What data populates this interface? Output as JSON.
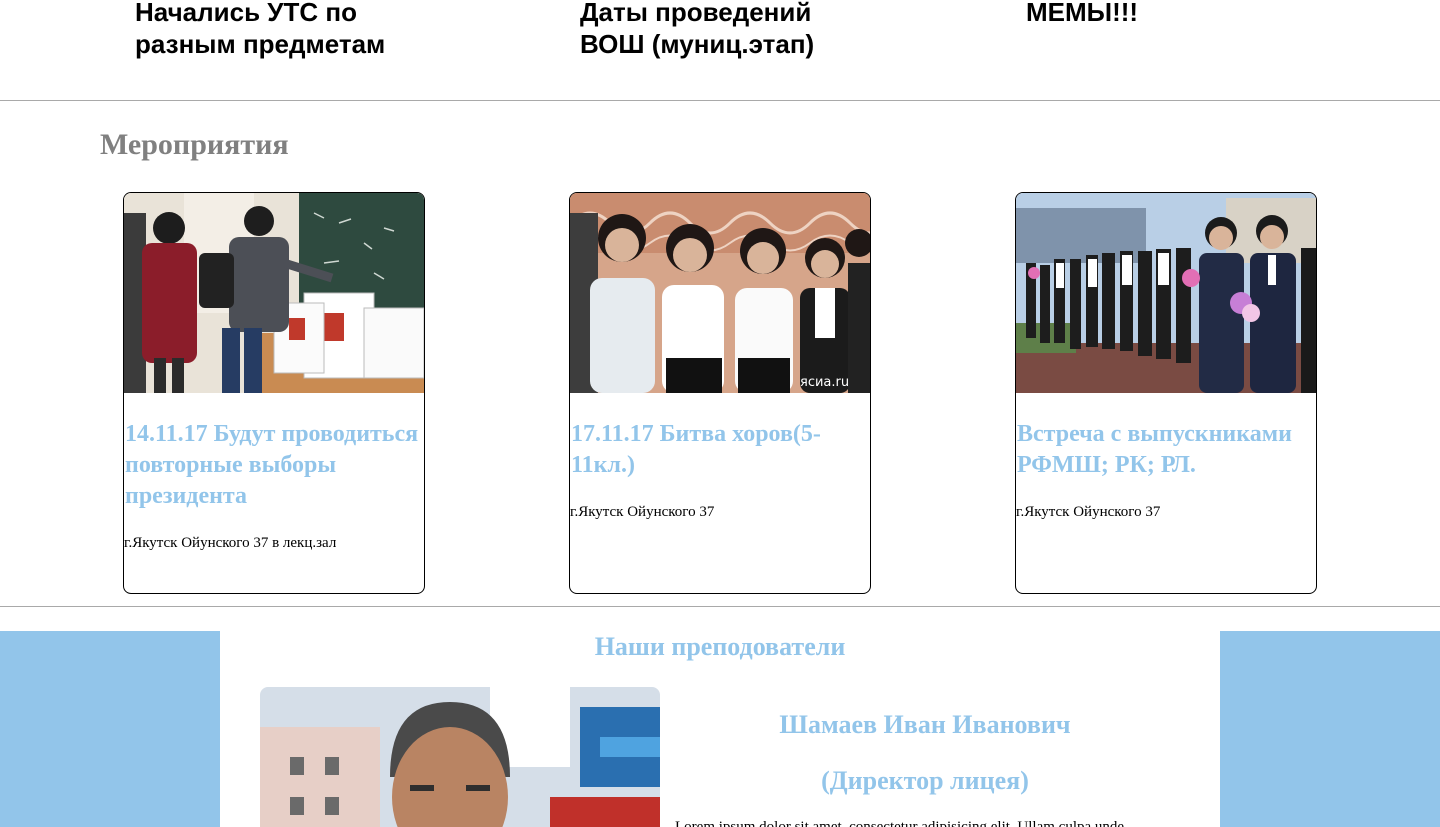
{
  "news": [
    {
      "title": "Начались УТС по разным предметам"
    },
    {
      "title": "Даты проведений ВОШ (муниц.этап)"
    },
    {
      "title": "МЕМЫ!!!"
    }
  ],
  "events": {
    "heading": "Мероприятия",
    "items": [
      {
        "title": "14.11.17 Будут проводиться повторные выборы президента",
        "address": "г.Якутск Ойунского 37 в лекц.зал",
        "image_alt": "students-voting-photo"
      },
      {
        "title": "17.11.17 Битва хоров(5-11кл.)",
        "address": "г.Якутск Ойунского 37",
        "image_alt": "choir-photo",
        "watermark": "ясиа.ru"
      },
      {
        "title": "Встреча с выпускниками РФМШ; РК; РЛ.",
        "address": "г.Якутск Ойунского 37",
        "image_alt": "graduates-photo"
      }
    ]
  },
  "teachers": {
    "heading": "Наши преподователи",
    "name": "Шамаев Иван Иванович",
    "role": "(Директор лицея)",
    "bio": "Lorem ipsum dolor sit amet, consectetur adipisicing elit. Ullam culpa unde"
  },
  "colors": {
    "accent": "#92c5ea",
    "heading_gray": "#808080",
    "rule": "#a9a9a9"
  }
}
